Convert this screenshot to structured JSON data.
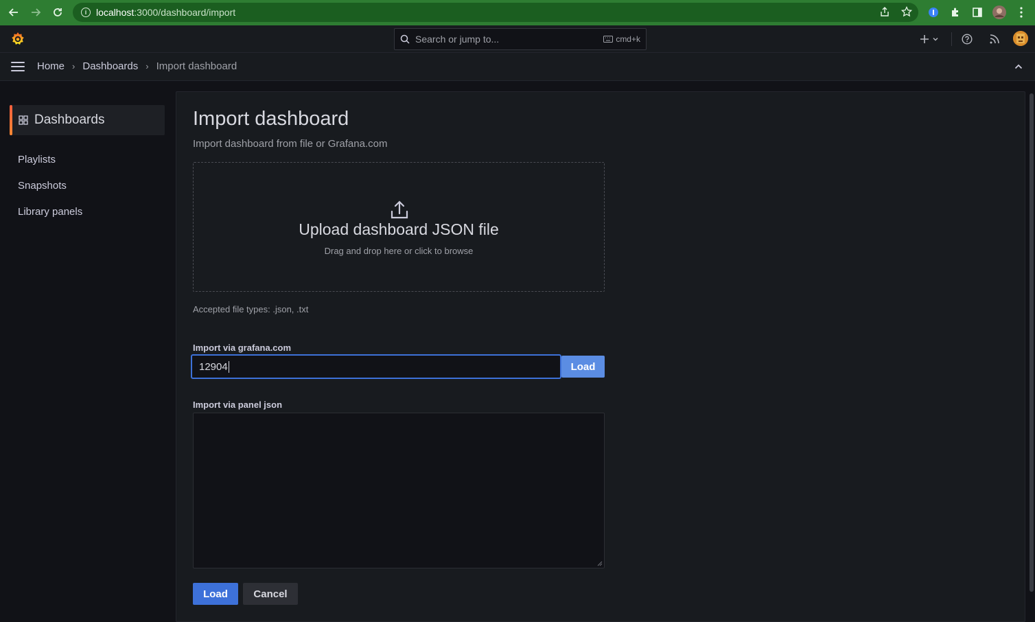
{
  "browser": {
    "url_host": "localhost",
    "url_path": ":3000/dashboard/import"
  },
  "topbar": {
    "search_placeholder": "Search or jump to...",
    "search_shortcut": "cmd+k"
  },
  "breadcrumb": {
    "home": "Home",
    "dashboards": "Dashboards",
    "current": "Import dashboard"
  },
  "sidebar": {
    "section_title": "Dashboards",
    "items": [
      {
        "label": "Playlists"
      },
      {
        "label": "Snapshots"
      },
      {
        "label": "Library panels"
      }
    ]
  },
  "main": {
    "title": "Import dashboard",
    "subtitle": "Import dashboard from file or Grafana.com",
    "upload_title": "Upload dashboard JSON file",
    "upload_subtitle": "Drag and drop here or click to browse",
    "accepted_types": "Accepted file types: .json, .txt",
    "gcom_label": "Import via grafana.com",
    "gcom_value": "12904",
    "gcom_load": "Load",
    "panel_json_label": "Import via panel json",
    "panel_json_value": "",
    "load_button": "Load",
    "cancel_button": "Cancel"
  },
  "colors": {
    "accent_blue": "#3d71d9",
    "brand_orange": "#f55f3e",
    "browser_green": "#2e7d32"
  }
}
